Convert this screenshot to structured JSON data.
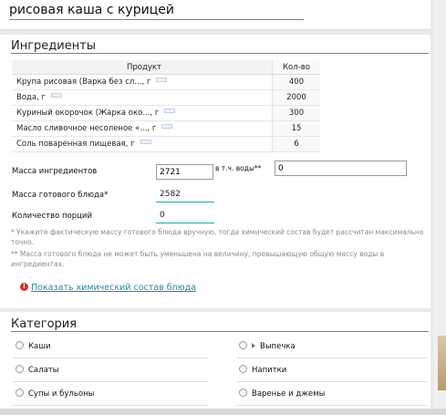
{
  "dish": {
    "title": "рисовая каша с курицей"
  },
  "ingredients": {
    "heading": "Ингредиенты",
    "col_product": "Продукт",
    "col_qty": "Кол-во",
    "rows": [
      {
        "name": "Крупа рисовая (Варка без сл..., г",
        "qty": "400"
      },
      {
        "name": "Вода, г",
        "qty": "2000"
      },
      {
        "name": "Куриный окорочок (Жарка око..., г",
        "qty": "300"
      },
      {
        "name": "Масло сливочное несоленое «..., г",
        "qty": "15"
      },
      {
        "name": "Соль поваренная пищевая, г",
        "qty": "6"
      }
    ]
  },
  "form": {
    "mass_label": "Масса ингредиентов",
    "mass_value": "2721",
    "water_label": "в т.ч. воды**",
    "water_value": "0",
    "ready_label": "Масса готового блюда*",
    "ready_value": "2582",
    "portions_label": "Количество порций",
    "portions_value": "0",
    "note1": "* Укажите фактическую массу готового блюда вручную, тогда химический состав будет рассчитан максимально точно.",
    "note2": "** Масса готового блюда не может быть уменьшена на величину, превышающую общую массу воды в ингредиентах."
  },
  "chem_link": "Показать химический состав блюда",
  "category": {
    "heading": "Категория",
    "items": [
      "Каши",
      "Выпечка",
      "Салаты",
      "Напитки",
      "Супы и бульоны",
      "Варенье и джемы"
    ]
  },
  "colors": {
    "accent": "#2aa59b",
    "link": "#2a8a98",
    "alert": "#d2322d"
  }
}
